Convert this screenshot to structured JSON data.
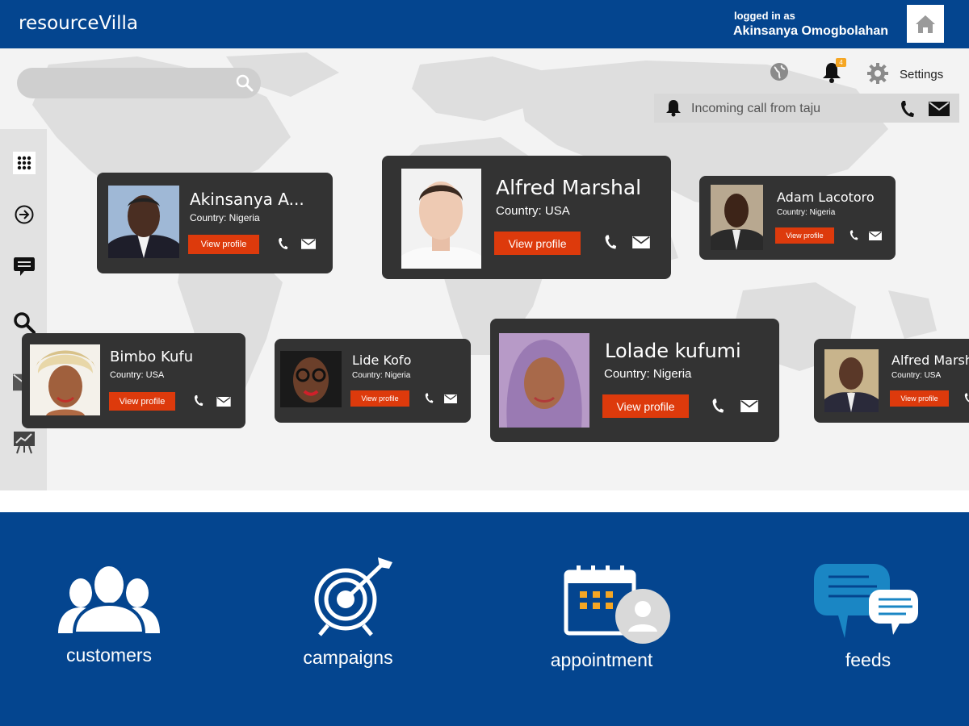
{
  "header": {
    "brand": "resourceVilla",
    "logged_label": "logged in as",
    "user_name": "Akinsanya Omogbolahan"
  },
  "search": {
    "value": "",
    "placeholder": ""
  },
  "toolbar": {
    "notification_count": "4",
    "settings_label": "Settings"
  },
  "call": {
    "text": "Incoming call from taju"
  },
  "cards": [
    {
      "name": "Akinsanya A...",
      "country": "Country: Nigeria",
      "button": "View profile"
    },
    {
      "name": "Alfred Marshal",
      "country": "Country: USA",
      "button": "View profile"
    },
    {
      "name": "Adam Lacotoro",
      "country": "Country: Nigeria",
      "button": "View profile"
    },
    {
      "name": "Bimbo Kufu",
      "country": "Country: USA",
      "button": "View profile"
    },
    {
      "name": "Lide Kofo",
      "country": "Country: Nigeria",
      "button": "View profile"
    },
    {
      "name": "Lolade kufumi",
      "country": "Country: Nigeria",
      "button": "View profile"
    },
    {
      "name": "Alfred Marshal",
      "country": "Country: USA",
      "button": "View profile"
    }
  ],
  "bottom_nav": [
    {
      "label": "customers"
    },
    {
      "label": "campaigns"
    },
    {
      "label": "appointment"
    },
    {
      "label": "feeds"
    }
  ],
  "colors": {
    "brand_blue": "#04458f",
    "accent_orange": "#dd3a0c",
    "card_bg": "#333333"
  }
}
